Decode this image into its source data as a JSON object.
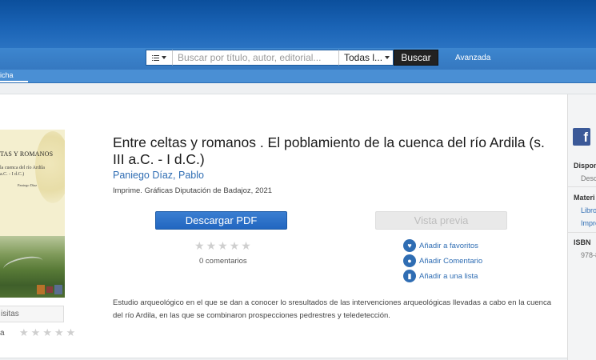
{
  "header": {
    "search": {
      "placeholder": "Buscar por título, autor, editorial...",
      "category_value": "Todas l...",
      "submit_label": "Buscar"
    },
    "advanced_link": "Avanzada",
    "nav_tab": "icha"
  },
  "cover": {
    "title": "TAS Y ROMANOS",
    "subtitle_1": "la cuenca del río Ardila",
    "subtitle_2": "a.C. - I d.C.)",
    "author": "Paniego Díaz"
  },
  "left": {
    "visits_label": "isitas",
    "rating_label": "a"
  },
  "book": {
    "title": "Entre celtas y romanos . El poblamiento de la cuenca del río Ardila (s. III a.C. - I d.C.)",
    "author": "Paniego Díaz, Pablo",
    "publisher": "Imprime. Gráficas Diputación de Badajoz, 2021",
    "download_label": "Descargar PDF",
    "preview_label": "Vista previa",
    "comments_count": "0 comentarios",
    "description": "Estudio arqueológico en el que se dan a conocer lo sresultados de las intervenciones arqueológicas llevadas a cabo en la cuenca del río Ardila, en las que se combinaron prospecciones pedrestres y teledetección."
  },
  "actions": [
    {
      "label": "Añadir a favoritos",
      "icon": "heart-icon"
    },
    {
      "label": "Añadir Comentario",
      "icon": "comment-icon"
    },
    {
      "label": "Añadir a una lista",
      "icon": "bookmark-icon"
    }
  ],
  "rating": {
    "value": 0,
    "max": 5
  },
  "right_panel": {
    "facebook": "f",
    "disp_label": "Dispon",
    "disp_value": "Desc",
    "material_label": "Materi",
    "material_1": "Libro",
    "material_2": "Impre",
    "isbn_label": "ISBN",
    "isbn_value": "978-8"
  },
  "colors": {
    "header_top": "#0b4f9c",
    "header_bottom": "#3578c0",
    "link": "#2f6db3",
    "primary_button": "#2266c0",
    "facebook": "#3b5998"
  }
}
